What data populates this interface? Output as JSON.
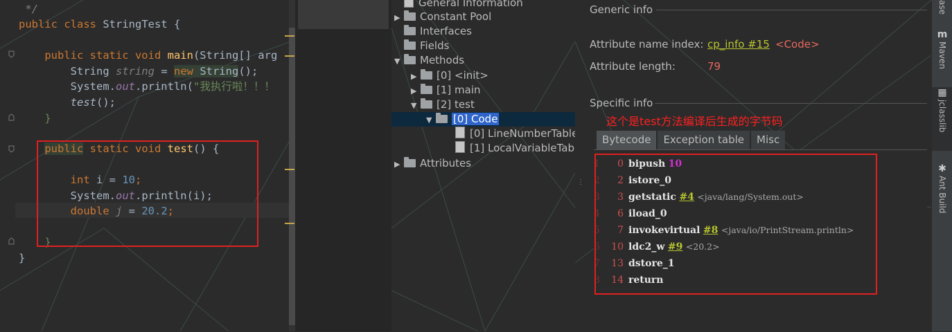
{
  "editor": {
    "lines": [
      {
        "tokens": [
          {
            "t": " */",
            "c": "cm"
          }
        ]
      },
      {
        "tokens": [
          {
            "t": "public class ",
            "c": "kw"
          },
          {
            "t": "StringTest {",
            "c": ""
          }
        ]
      },
      {
        "tokens": []
      },
      {
        "tokens": [
          {
            "t": "    public static void ",
            "c": "kw"
          },
          {
            "t": "main",
            "c": "fn"
          },
          {
            "t": "(String[] arg",
            "c": ""
          }
        ]
      },
      {
        "tokens": [
          {
            "t": "        String ",
            "c": ""
          },
          {
            "t": "string",
            "c": "cm"
          },
          {
            "t": " = ",
            "c": ""
          },
          {
            "t": "new",
            "c": "kw hl"
          },
          {
            "t": " String",
            "c": "hl"
          },
          {
            "t": "();",
            "c": ""
          }
        ]
      },
      {
        "tokens": [
          {
            "t": "        System.",
            "c": ""
          },
          {
            "t": "out",
            "c": "fld"
          },
          {
            "t": ".println(",
            "c": ""
          },
          {
            "t": "\"我执行啦！！！",
            "c": "str"
          }
        ]
      },
      {
        "tokens": [
          {
            "t": "        ",
            "c": ""
          },
          {
            "t": "test",
            "c": "it"
          },
          {
            "t": "();",
            "c": ""
          }
        ]
      },
      {
        "tokens": [
          {
            "t": "    }",
            "c": "str"
          }
        ]
      },
      {
        "tokens": []
      },
      {
        "tokens": [
          {
            "t": "    ",
            "c": ""
          },
          {
            "t": "public",
            "c": "kw hl"
          },
          {
            "t": " static void ",
            "c": "kw"
          },
          {
            "t": "test",
            "c": "fn"
          },
          {
            "t": "() {",
            "c": ""
          }
        ]
      },
      {
        "tokens": []
      },
      {
        "tokens": [
          {
            "t": "        int ",
            "c": "kw"
          },
          {
            "t": "i = ",
            "c": ""
          },
          {
            "t": "10",
            "c": "num"
          },
          {
            "t": ";",
            "c": "kw"
          }
        ]
      },
      {
        "tokens": [
          {
            "t": "        System.",
            "c": ""
          },
          {
            "t": "out",
            "c": "fld"
          },
          {
            "t": ".println(i);",
            "c": ""
          }
        ]
      },
      {
        "tokens": [
          {
            "t": "        double ",
            "c": "kw"
          },
          {
            "t": "j",
            "c": "cm"
          },
          {
            "t": " = ",
            "c": ""
          },
          {
            "t": "20.2",
            "c": "num"
          },
          {
            "t": ";",
            "c": "kw"
          }
        ]
      },
      {
        "tokens": []
      },
      {
        "tokens": [
          {
            "t": "    }",
            "c": "str"
          }
        ]
      },
      {
        "tokens": [
          {
            "t": "}",
            "c": ""
          }
        ]
      }
    ]
  },
  "tree": {
    "general_information": "General Information",
    "constant_pool": "Constant Pool",
    "interfaces": "Interfaces",
    "fields": "Fields",
    "methods": "Methods",
    "method_init": "[0] <init>",
    "method_main": "[1] main",
    "method_test": "[2] test",
    "code": "[0] Code",
    "line_number_table": "[0] LineNumberTable",
    "local_variable_table": "[1] LocalVariableTable",
    "attributes": "Attributes"
  },
  "info": {
    "generic_title": "Generic info",
    "attr_name_index_label": "Attribute name index:",
    "attr_name_index_link": "cp_info #15",
    "attr_name_index_value": "<Code>",
    "attr_length_label": "Attribute length:",
    "attr_length_value": "79",
    "specific_title": "Specific info",
    "annotation": "这个是test方法编译后生成的字节码",
    "tabs": [
      "Bytecode",
      "Exception table",
      "Misc"
    ]
  },
  "bytecode": [
    {
      "ln": "1",
      "off": "0",
      "op": "bipush",
      "arg": "10",
      "argtype": "num",
      "cm": ""
    },
    {
      "ln": "2",
      "off": "2",
      "op": "istore_0",
      "arg": "",
      "argtype": "",
      "cm": ""
    },
    {
      "ln": "3",
      "off": "3",
      "op": "getstatic",
      "arg": "#4",
      "argtype": "ref",
      "cm": "<java/lang/System.out>"
    },
    {
      "ln": "4",
      "off": "6",
      "op": "iload_0",
      "arg": "",
      "argtype": "",
      "cm": ""
    },
    {
      "ln": "5",
      "off": "7",
      "op": "invokevirtual",
      "arg": "#8",
      "argtype": "ref",
      "cm": "<java/io/PrintStream.println>"
    },
    {
      "ln": "6",
      "off": "10",
      "op": "ldc2_w",
      "arg": "#9",
      "argtype": "ref",
      "cm": "<20.2>"
    },
    {
      "ln": "7",
      "off": "13",
      "op": "dstore_1",
      "arg": "",
      "argtype": "",
      "cm": ""
    },
    {
      "ln": "8",
      "off": "14",
      "op": "return",
      "arg": "",
      "argtype": "",
      "cm": ""
    }
  ],
  "side_toolbar": {
    "top_label": "ase",
    "maven": "Maven",
    "jclasslib": "jclasslib",
    "ant": "Ant Build"
  }
}
